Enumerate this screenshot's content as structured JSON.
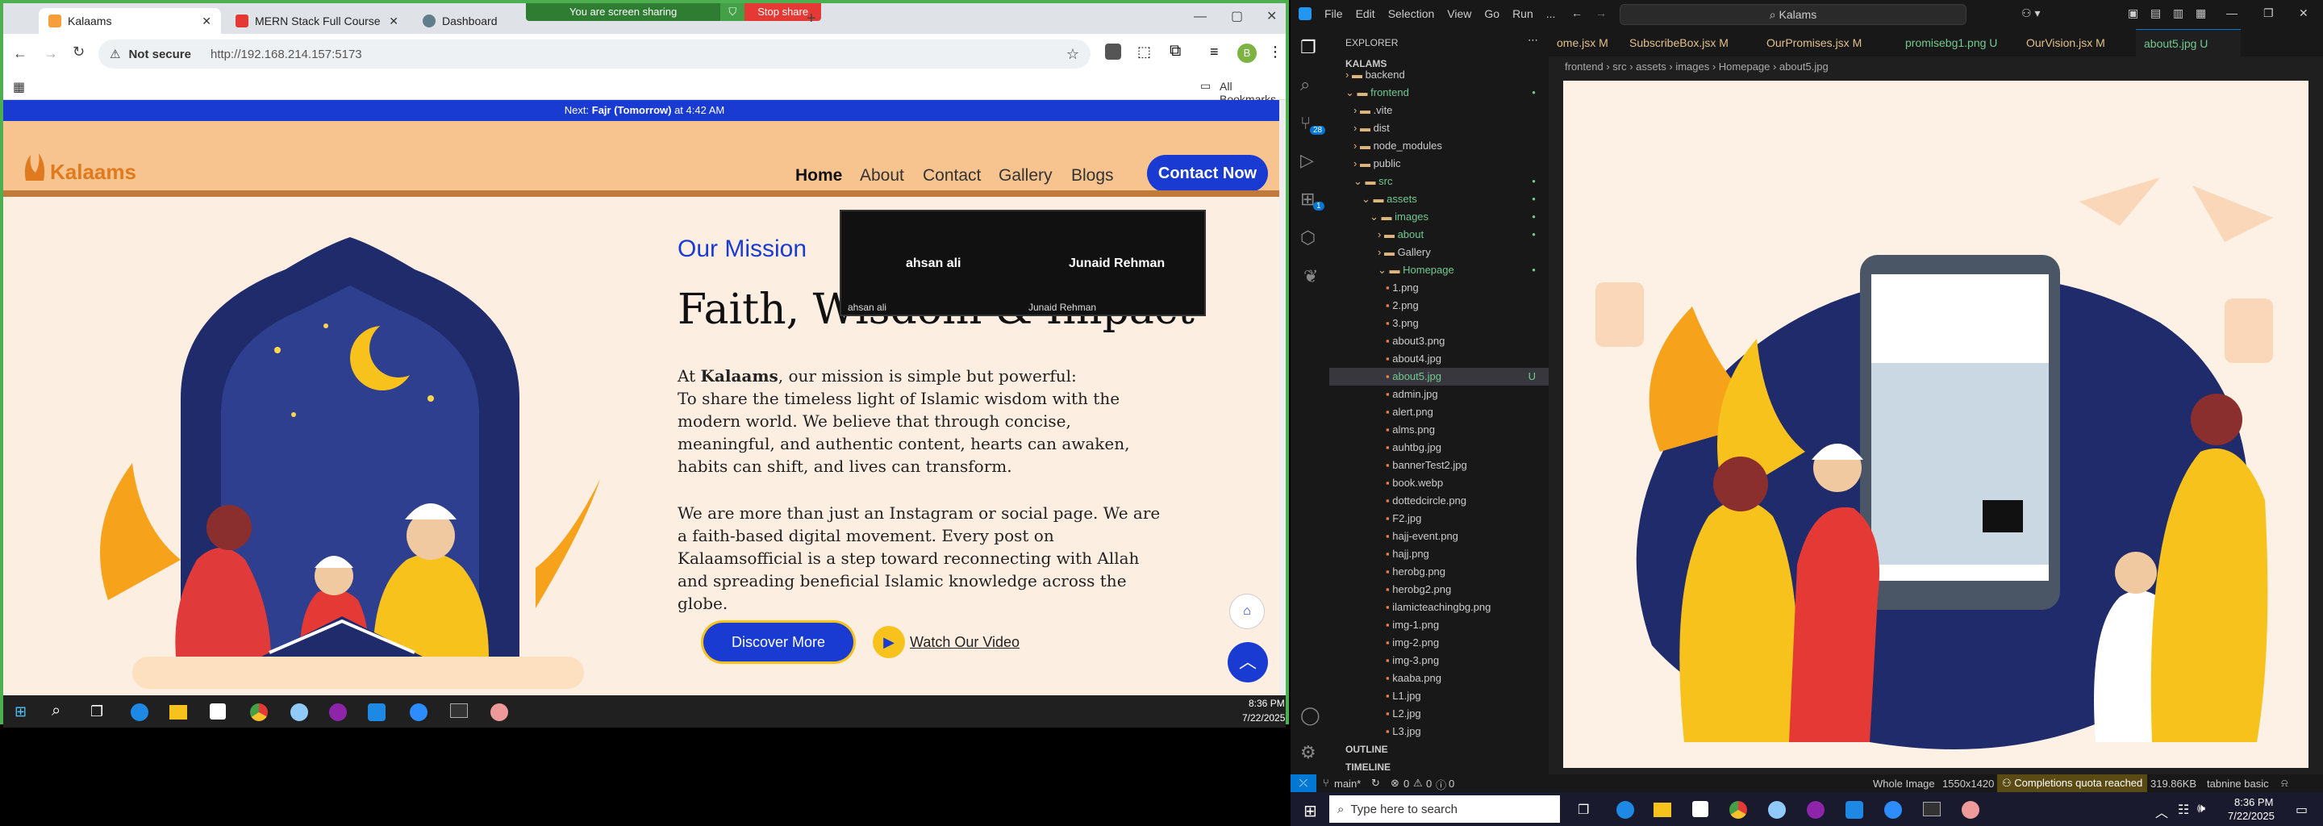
{
  "chrome": {
    "tabs": [
      {
        "label": "Kalaams",
        "active": true
      },
      {
        "label": "MERN Stack Full Course - ECom",
        "active": false
      },
      {
        "label": "Dashboard",
        "active": false
      }
    ],
    "share_text": "You are screen sharing",
    "stop_share": "Stop share",
    "not_secure": "Not secure",
    "url": "http://192.168.214.157:5173",
    "all_bookmarks": "All Bookmarks",
    "profile_initial": "B"
  },
  "site": {
    "prayer_prefix": "Next: ",
    "prayer_name": "Fajr (Tomorrow)",
    "prayer_suffix": " at 4:42 AM",
    "brand": "Kalaams",
    "nav": [
      "Home",
      "About",
      "Contact",
      "Gallery",
      "Blogs"
    ],
    "contact_button": "Contact Now",
    "section_label": "Our Mission",
    "heading": "Faith, Wisdom & Impact",
    "p1_at": "At ",
    "p1_brand": "Kalaams",
    "p1_rest": ", our mission is simple but powerful:",
    "p1_body": "To share the timeless light of Islamic wisdom with the modern world. We believe that through concise, meaningful, and authentic content, hearts can awaken, habits can shift, and lives can transform.",
    "p2": "We are more than just an Instagram or social page. We are a faith-based digital movement. Every post on Kalaamsofficial is a step toward reconnecting with Allah and spreading beneficial Islamic knowledge across the globe.",
    "discover": "Discover More",
    "watch": "Watch Our Video",
    "video_participants": [
      {
        "name": "ahsan ali",
        "caption": "ahsan ali"
      },
      {
        "name": "Junaid Rehman",
        "caption": "Junaid Rehman"
      }
    ]
  },
  "taskbar_left": {
    "time": "8:36 PM",
    "date": "7/22/2025"
  },
  "vscode": {
    "menu": [
      "File",
      "Edit",
      "Selection",
      "View",
      "Go",
      "Run",
      "..."
    ],
    "search": "Kalams",
    "explorer_title": "EXPLORER",
    "root": "KALAMS",
    "tree": [
      {
        "label": "backend",
        "depth": 1,
        "type": "folder",
        "open": false
      },
      {
        "label": "frontend",
        "depth": 1,
        "type": "folder",
        "open": true,
        "color": "#73c991"
      },
      {
        "label": ".vite",
        "depth": 2,
        "type": "folder",
        "open": false
      },
      {
        "label": "dist",
        "depth": 2,
        "type": "folder",
        "open": false
      },
      {
        "label": "node_modules",
        "depth": 2,
        "type": "folder",
        "open": false
      },
      {
        "label": "public",
        "depth": 2,
        "type": "folder",
        "open": false
      },
      {
        "label": "src",
        "depth": 2,
        "type": "folder",
        "open": true,
        "color": "#73c991"
      },
      {
        "label": "assets",
        "depth": 3,
        "type": "folder",
        "open": true,
        "color": "#73c991"
      },
      {
        "label": "images",
        "depth": 4,
        "type": "folder",
        "open": true,
        "color": "#73c991"
      },
      {
        "label": "about",
        "depth": 5,
        "type": "folder",
        "open": false,
        "color": "#73c991"
      },
      {
        "label": "Gallery",
        "depth": 5,
        "type": "folder",
        "open": false
      },
      {
        "label": "Homepage",
        "depth": 5,
        "type": "folder",
        "open": true,
        "color": "#73c991"
      },
      {
        "label": "1.png",
        "depth": 6,
        "type": "file"
      },
      {
        "label": "2.png",
        "depth": 6,
        "type": "file"
      },
      {
        "label": "3.png",
        "depth": 6,
        "type": "file"
      },
      {
        "label": "about3.png",
        "depth": 6,
        "type": "file"
      },
      {
        "label": "about4.jpg",
        "depth": 6,
        "type": "file"
      },
      {
        "label": "about5.jpg",
        "depth": 6,
        "type": "file",
        "selected": true,
        "badge": "U",
        "color": "#73c991"
      },
      {
        "label": "admin.jpg",
        "depth": 6,
        "type": "file"
      },
      {
        "label": "alert.png",
        "depth": 6,
        "type": "file"
      },
      {
        "label": "alms.png",
        "depth": 6,
        "type": "file"
      },
      {
        "label": "auhtbg.jpg",
        "depth": 6,
        "type": "file"
      },
      {
        "label": "bannerTest2.jpg",
        "depth": 6,
        "type": "file"
      },
      {
        "label": "book.webp",
        "depth": 6,
        "type": "file"
      },
      {
        "label": "dottedcircle.png",
        "depth": 6,
        "type": "file"
      },
      {
        "label": "F2.jpg",
        "depth": 6,
        "type": "file"
      },
      {
        "label": "hajj-event.png",
        "depth": 6,
        "type": "file"
      },
      {
        "label": "hajj.png",
        "depth": 6,
        "type": "file"
      },
      {
        "label": "herobg.png",
        "depth": 6,
        "type": "file"
      },
      {
        "label": "herobg2.png",
        "depth": 6,
        "type": "file"
      },
      {
        "label": "ilamicteachingbg.png",
        "depth": 6,
        "type": "file"
      },
      {
        "label": "img-1.png",
        "depth": 6,
        "type": "file"
      },
      {
        "label": "img-2.png",
        "depth": 6,
        "type": "file"
      },
      {
        "label": "img-3.png",
        "depth": 6,
        "type": "file"
      },
      {
        "label": "kaaba.png",
        "depth": 6,
        "type": "file"
      },
      {
        "label": "L1.jpg",
        "depth": 6,
        "type": "file"
      },
      {
        "label": "L2.jpg",
        "depth": 6,
        "type": "file"
      },
      {
        "label": "L3.jpg",
        "depth": 6,
        "type": "file"
      }
    ],
    "outline": "OUTLINE",
    "timeline": "TIMELINE",
    "tabs": [
      {
        "label": "ome.jsx",
        "mod": "M"
      },
      {
        "label": "SubscribeBox.jsx",
        "mod": "M"
      },
      {
        "label": "OurPromises.jsx",
        "mod": "M"
      },
      {
        "label": "promisebg1.png",
        "mod": "U"
      },
      {
        "label": "OurVision.jsx",
        "mod": "M"
      },
      {
        "label": "about5.jpg",
        "mod": "U",
        "active": true
      }
    ],
    "breadcrumb": [
      "frontend",
      "src",
      "assets",
      "images",
      "Homepage",
      "about5.jpg"
    ],
    "status": {
      "branch": "main*",
      "errors": "0",
      "warnings": "0",
      "info": "0",
      "whole_image": "Whole Image",
      "dims": "1550x1420",
      "quota": "Completions quota reached",
      "size": "319.86KB",
      "tabnine": "tabnine basic"
    },
    "activity_badges": {
      "scm": "28",
      "ext": "1"
    }
  },
  "taskbar_right": {
    "search": "Type here to search",
    "time": "8:36 PM",
    "date": "7/22/2025"
  }
}
